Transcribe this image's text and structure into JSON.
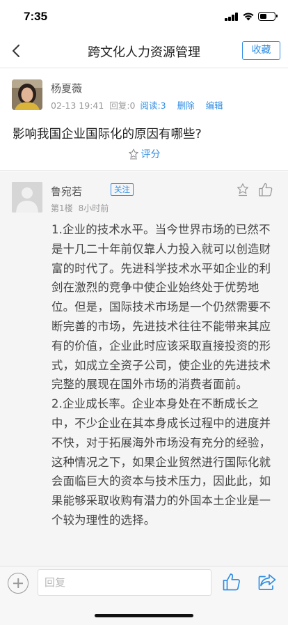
{
  "status_bar": {
    "time": "7:35"
  },
  "nav": {
    "title": "跨文化人力资源管理",
    "favorite_label": "收藏"
  },
  "question": {
    "asker_name": "杨夏薇",
    "time": "02-13 19:41",
    "reply_count": "回复:0",
    "read_count": "阅读:3",
    "delete_label": "删除",
    "edit_label": "编辑",
    "title": "影响我国企业国际化的原因有哪些?",
    "rate_label": "评分"
  },
  "answer": {
    "name": "鲁宛若",
    "follow_label": "关注",
    "floor": "第1楼",
    "time_ago": "8小时前",
    "paragraphs": [
      "1.企业的技术水平。当今世界市场的已然不是十几二十年前仅靠人力投入就可以创造财富的时代了。先进科学技术水平如企业的利剑在激烈的竞争中使企业始终处于优势地位。但是，国际技术市场是一个仍然需要不断完善的市场，先进技术往往不能带来其应有的价值，企业此时应该采取直接投资的形式，如成立全资子公司，使企业的先进技术完整的展现在国外市场的消费者面前。",
      "2.企业成长率。企业本身处在不断成长之中，不少企业在其本身成长过程中的进度并不快，对于拓展海外市场没有充分的经验，这种情况之下，如果企业贸然进行国际化就会面临巨大的资本与技术压力，因此此，如果能够采取收购有潜力的外国本土企业是一个较为理性的选择。"
    ]
  },
  "bottom_bar": {
    "reply_placeholder": "回复"
  },
  "colors": {
    "accent": "#2f8de4",
    "answer_bg": "#f5f5f5",
    "text": "#444444"
  }
}
